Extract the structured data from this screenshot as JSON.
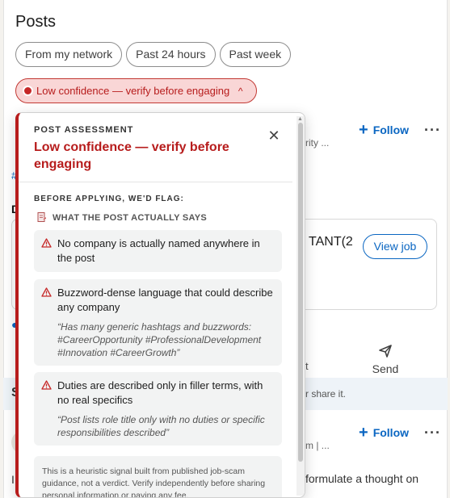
{
  "feed": {
    "title": "Posts",
    "filters": [
      "From my network",
      "Past 24 hours",
      "Past week"
    ],
    "confidence_badge": {
      "label": "Low confidence — verify before engaging",
      "caret": "^"
    },
    "post1": {
      "follow": "Follow",
      "meta_partial": "rity ...",
      "hashtag_partial": "#",
      "partial_char": "D"
    },
    "job_card": {
      "title_partial": "TANT(2",
      "view_job": "View job"
    },
    "actions": {
      "send": "Send",
      "partial": "t"
    },
    "share_hint": "r share it.",
    "left_partial_s": "S",
    "post2": {
      "follow": "Follow",
      "meta_partial": "m | ..."
    },
    "thought_text": "formulate a thought on",
    "left_partial_i": "I"
  },
  "popover": {
    "label": "POST ASSESSMENT",
    "title": "Low confidence — verify before engaging",
    "flag_label": "BEFORE APPLYING, WE'D FLAG:",
    "section": "WHAT THE POST ACTUALLY SAYS",
    "items": [
      {
        "title": "No company is actually named anywhere in the post",
        "quote": ""
      },
      {
        "title": "Buzzword-dense language that could describe any company",
        "quote": "“Has many generic hashtags and buzzwords: #CareerOpportunity #ProfessionalDevelopment #Innovation #CareerGrowth”"
      },
      {
        "title": "Duties are described only in filler terms, with no real specifics",
        "quote": "“Post lists role title only with no duties or specific responsibilities described”"
      }
    ],
    "note": "This is a heuristic signal built from published job-scam guidance, not a verdict. Verify independently before sharing personal information or paying any fee."
  },
  "colors": {
    "accent": "#0a66c2",
    "warning": "#b71c1c",
    "badge_bg": "#f9d6d6"
  },
  "icons": [
    "close-icon",
    "warning-icon",
    "document-icon",
    "send-icon",
    "plus-icon",
    "more-icon"
  ]
}
